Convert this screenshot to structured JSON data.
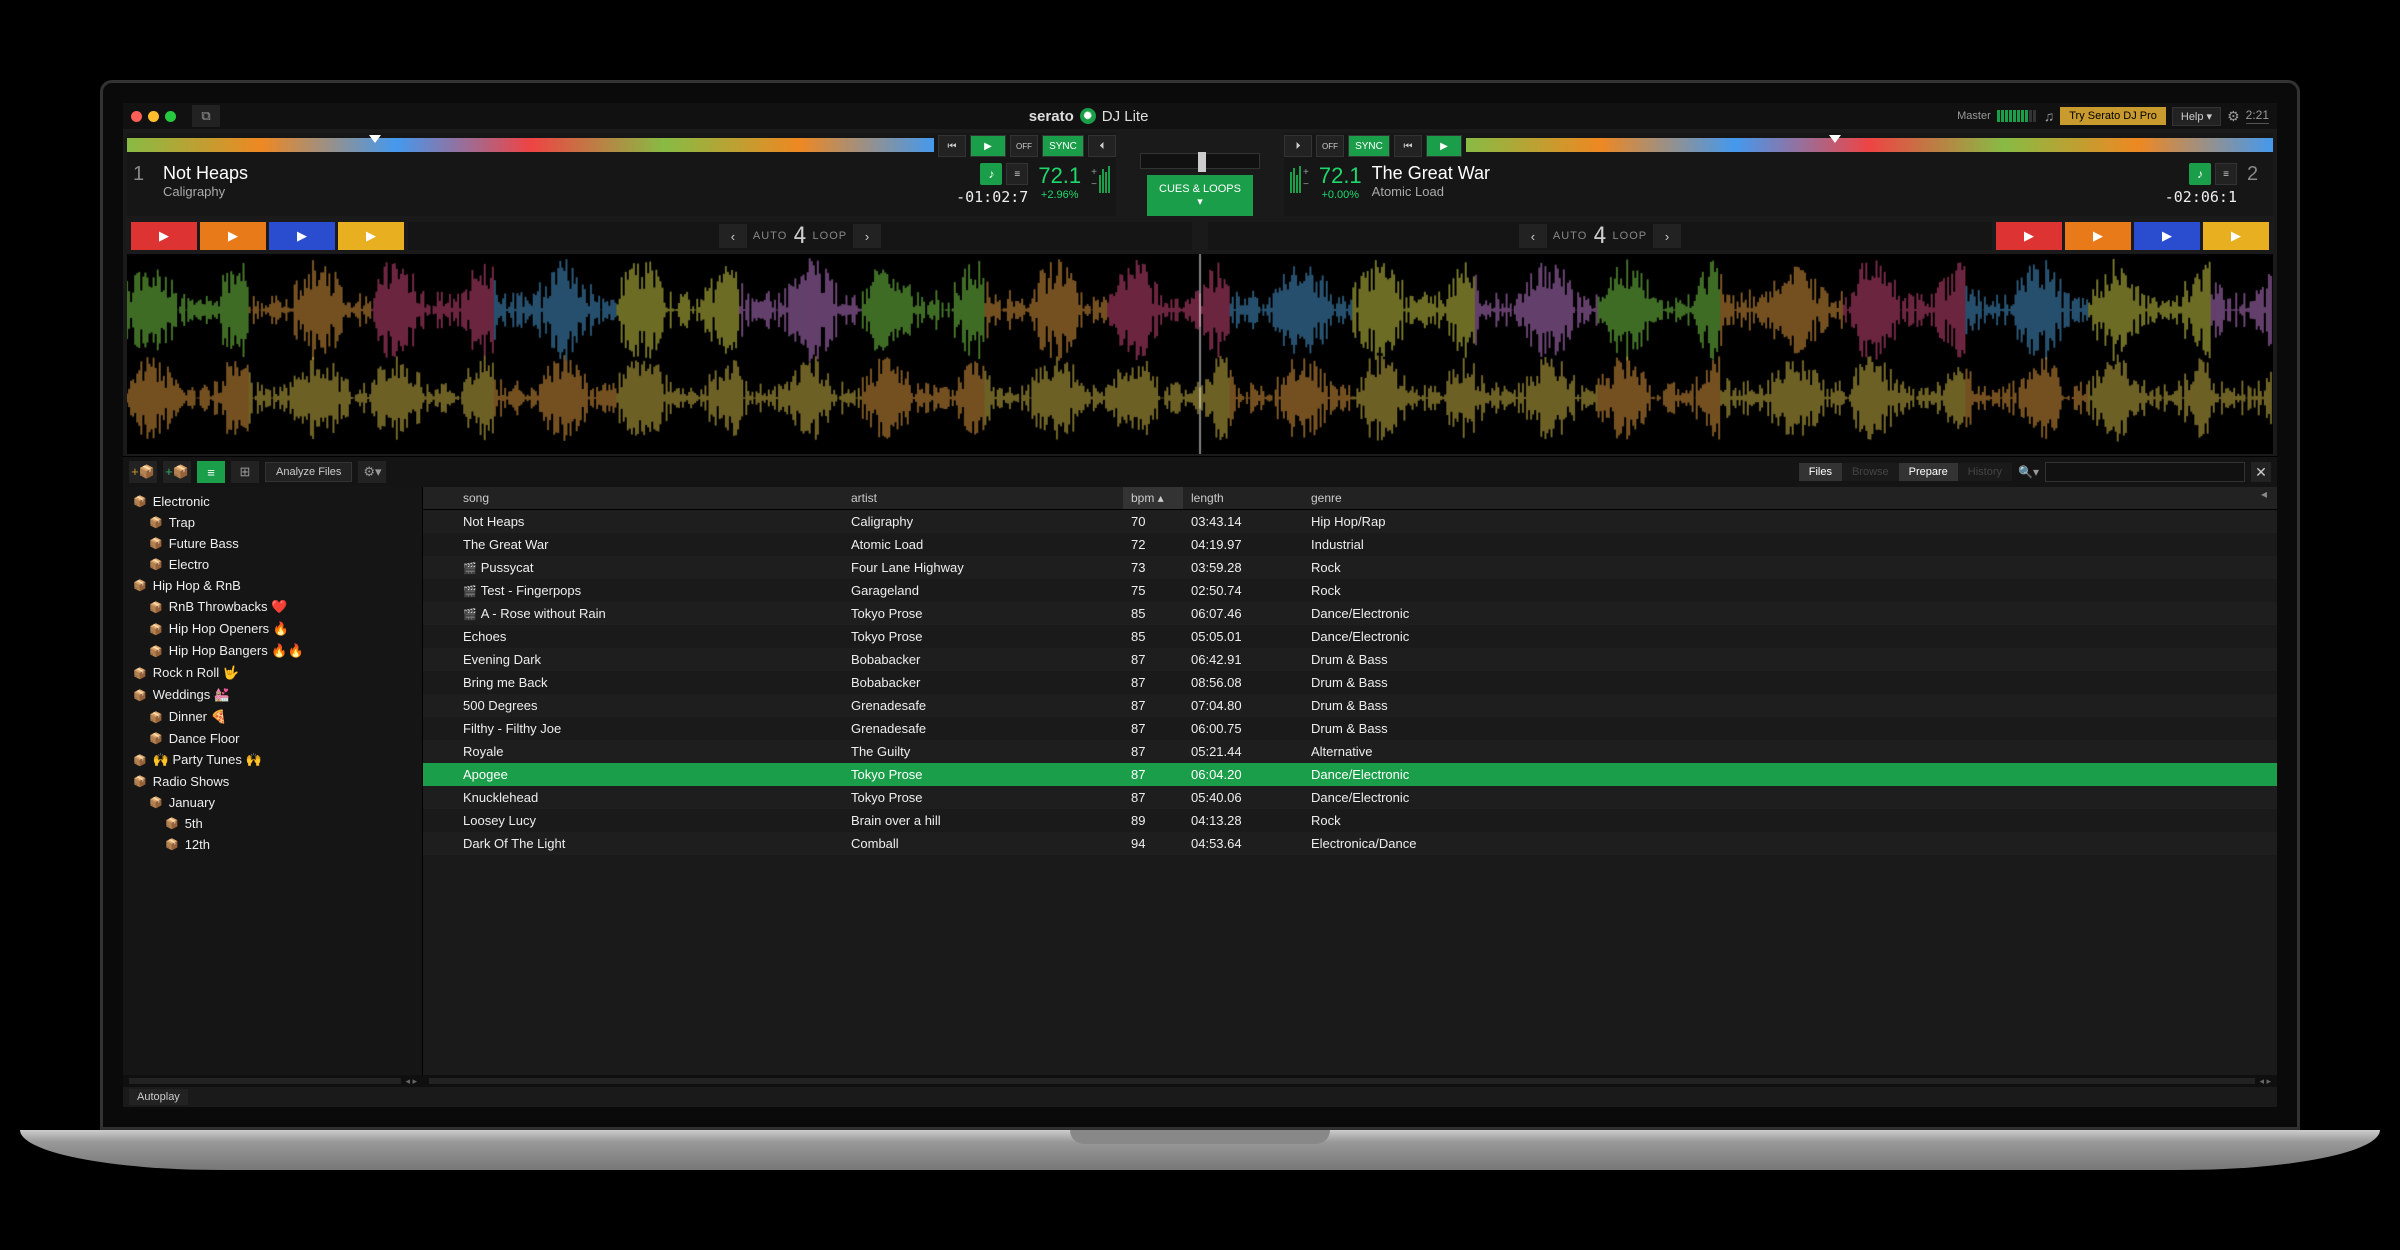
{
  "brand": {
    "name": "serato",
    "product": "DJ Lite"
  },
  "topbar": {
    "master": "Master",
    "try_pro": "Try Serato DJ Pro",
    "help": "Help",
    "clock": "2:21"
  },
  "deck1": {
    "num": "1",
    "title": "Not Heaps",
    "artist": "Caligraphy",
    "time": "-01:02:7",
    "bpm": "72.1",
    "pct": "+2.96%",
    "key": "♪",
    "sync": "SYNC",
    "off": "OFF"
  },
  "deck2": {
    "num": "2",
    "title": "The Great War",
    "artist": "Atomic Load",
    "time": "-02:06:1",
    "bpm": "72.1",
    "pct": "+0.00%",
    "key": "♪",
    "sync": "SYNC",
    "off": "OFF"
  },
  "center": {
    "cues": "CUES & LOOPS"
  },
  "loop": {
    "auto": "AUTO",
    "num": "4",
    "loop": "LOOP"
  },
  "libbar": {
    "analyze": "Analyze Files",
    "files": "Files",
    "browse": "Browse",
    "prepare": "Prepare",
    "history": "History",
    "search_ph": "",
    "autoplay": "Autoplay"
  },
  "crates": [
    {
      "lvl": 0,
      "label": "Electronic",
      "emoji": ""
    },
    {
      "lvl": 1,
      "label": "Trap",
      "emoji": ""
    },
    {
      "lvl": 1,
      "label": "Future Bass",
      "emoji": ""
    },
    {
      "lvl": 1,
      "label": "Electro",
      "emoji": ""
    },
    {
      "lvl": 0,
      "label": "Hip Hop & RnB",
      "emoji": ""
    },
    {
      "lvl": 1,
      "label": "RnB Throwbacks",
      "emoji": "❤️"
    },
    {
      "lvl": 1,
      "label": "Hip Hop Openers",
      "emoji": "🔥"
    },
    {
      "lvl": 1,
      "label": "Hip Hop Bangers",
      "emoji": "🔥🔥"
    },
    {
      "lvl": 0,
      "label": "Rock n Roll",
      "emoji": "🤟"
    },
    {
      "lvl": 0,
      "label": "Weddings",
      "emoji": "💒"
    },
    {
      "lvl": 1,
      "label": "Dinner",
      "emoji": "🍕"
    },
    {
      "lvl": 1,
      "label": "Dance Floor",
      "emoji": ""
    },
    {
      "lvl": 0,
      "label": "🙌 Party Tunes 🙌",
      "emoji": ""
    },
    {
      "lvl": 0,
      "label": "Radio Shows",
      "emoji": ""
    },
    {
      "lvl": 1,
      "label": "January",
      "emoji": ""
    },
    {
      "lvl": 2,
      "label": "5th",
      "emoji": ""
    },
    {
      "lvl": 2,
      "label": "12th",
      "emoji": ""
    }
  ],
  "columns": {
    "song": "song",
    "artist": "artist",
    "bpm": "bpm",
    "length": "length",
    "genre": "genre"
  },
  "tracks": [
    {
      "song": "Not Heaps",
      "artist": "Caligraphy",
      "bpm": "70",
      "length": "03:43.14",
      "genre": "Hip Hop/Rap",
      "vid": false
    },
    {
      "song": "The Great War",
      "artist": "Atomic Load",
      "bpm": "72",
      "length": "04:19.97",
      "genre": "Industrial",
      "vid": false
    },
    {
      "song": "Pussycat",
      "artist": "Four Lane Highway",
      "bpm": "73",
      "length": "03:59.28",
      "genre": "Rock",
      "vid": true
    },
    {
      "song": "Test - Fingerpops",
      "artist": "Garageland",
      "bpm": "75",
      "length": "02:50.74",
      "genre": "Rock",
      "vid": true
    },
    {
      "song": "A - Rose without Rain",
      "artist": "Tokyo Prose",
      "bpm": "85",
      "length": "06:07.46",
      "genre": "Dance/Electronic",
      "vid": true
    },
    {
      "song": "Echoes",
      "artist": "Tokyo Prose",
      "bpm": "85",
      "length": "05:05.01",
      "genre": "Dance/Electronic",
      "vid": false
    },
    {
      "song": "Evening Dark",
      "artist": "Bobabacker",
      "bpm": "87",
      "length": "06:42.91",
      "genre": "Drum & Bass",
      "vid": false
    },
    {
      "song": "Bring me Back",
      "artist": "Bobabacker",
      "bpm": "87",
      "length": "08:56.08",
      "genre": "Drum & Bass",
      "vid": false
    },
    {
      "song": "500 Degrees",
      "artist": "Grenadesafe",
      "bpm": "87",
      "length": "07:04.80",
      "genre": "Drum & Bass",
      "vid": false
    },
    {
      "song": "Filthy - Filthy Joe",
      "artist": "Grenadesafe",
      "bpm": "87",
      "length": "06:00.75",
      "genre": "Drum & Bass",
      "vid": false
    },
    {
      "song": "Royale",
      "artist": "The Guilty",
      "bpm": "87",
      "length": "05:21.44",
      "genre": "Alternative",
      "vid": false
    },
    {
      "song": "Apogee",
      "artist": "Tokyo Prose",
      "bpm": "87",
      "length": "06:04.20",
      "genre": "Dance/Electronic",
      "vid": false,
      "sel": true
    },
    {
      "song": "Knucklehead",
      "artist": "Tokyo Prose",
      "bpm": "87",
      "length": "05:40.06",
      "genre": "Dance/Electronic",
      "vid": false
    },
    {
      "song": "Loosey Lucy",
      "artist": "Brain over a hill",
      "bpm": "89",
      "length": "04:13.28",
      "genre": "Rock",
      "vid": false
    },
    {
      "song": "Dark Of The Light",
      "artist": "Comball",
      "bpm": "94",
      "length": "04:53.64",
      "genre": "Electronica/Dance",
      "vid": false
    }
  ]
}
